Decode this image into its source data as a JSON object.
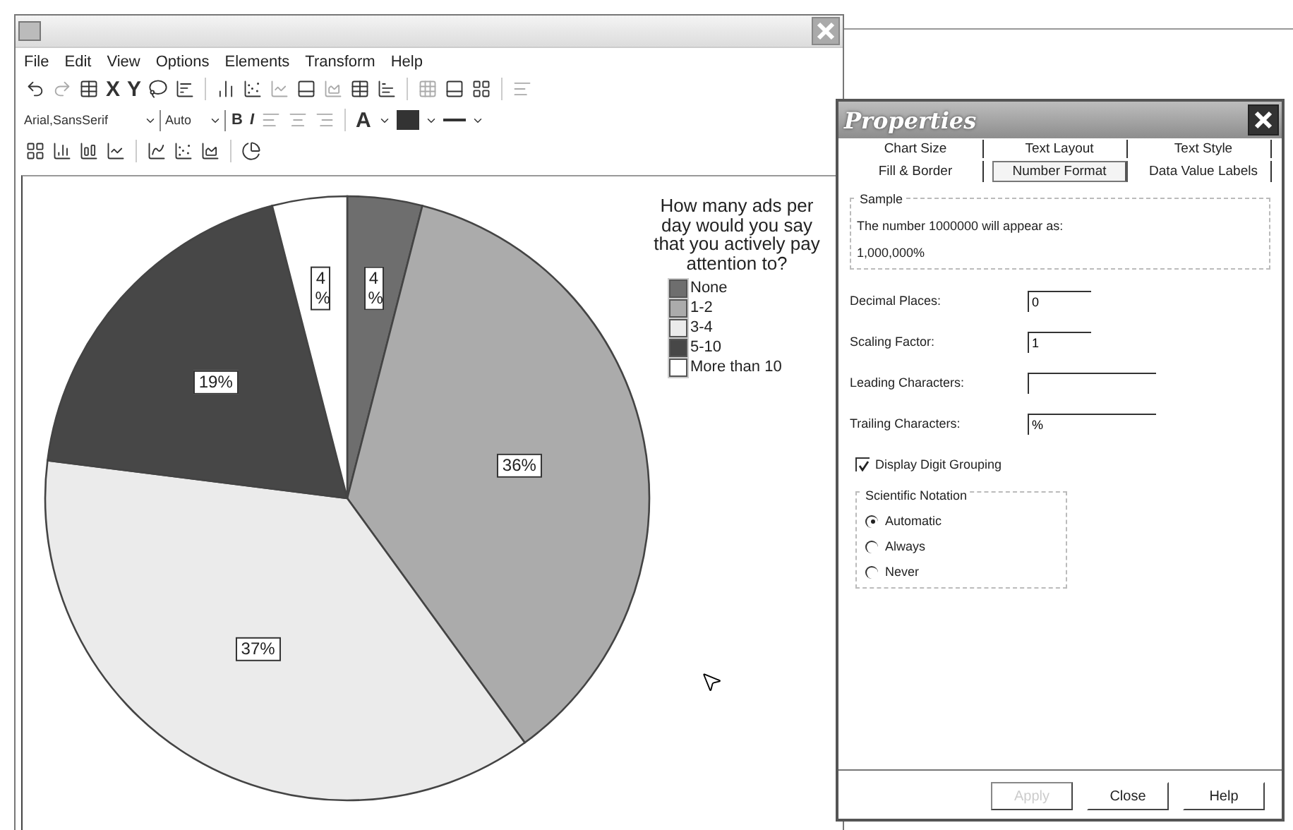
{
  "menu": [
    "File",
    "Edit",
    "View",
    "Options",
    "Elements",
    "Transform",
    "Help"
  ],
  "toolbar": {
    "x_axis": "X",
    "y_axis": "Y",
    "font": "Arial,SansSerif",
    "size": "Auto",
    "bold": "B",
    "italic": "I",
    "text_color": "A"
  },
  "chart": {
    "chart_data": {
      "type": "pie",
      "title": "How many ads per day would you say that you actively pay attention to?",
      "categories": [
        "None",
        "1-2",
        "3-4",
        "5-10",
        "More than 10"
      ],
      "values": [
        4,
        36,
        37,
        19,
        4
      ],
      "data_labels": true,
      "value_labels": [
        "4%",
        "36%",
        "37%",
        "19%",
        "4%"
      ]
    },
    "legend": [
      {
        "color": "#6e6e6e"
      },
      {
        "color": "#ababab"
      },
      {
        "color": "#ebebeb"
      },
      {
        "color": "#474747"
      },
      {
        "color": "#ffffff"
      }
    ]
  },
  "dialog": {
    "title": "Properties",
    "tab_rows": [
      [
        {
          "label": "Chart Size",
          "selected": false
        },
        {
          "label": "Text Layout",
          "selected": false
        },
        {
          "label": "Text Style",
          "selected": false
        }
      ],
      [
        {
          "label": "Fill & Border",
          "selected": false
        },
        {
          "label": "Number Format",
          "selected": true
        },
        {
          "label": "Data Value Labels",
          "selected": false
        }
      ]
    ],
    "sample": {
      "title": "Sample",
      "text": "The number 1000000 will appear as:",
      "value": "1,000,000%"
    },
    "fields": [
      {
        "label": "Decimal Places:",
        "value": "0"
      },
      {
        "label": "Scaling Factor:",
        "value": "1"
      },
      {
        "label": "Leading Characters:"
      },
      {
        "label": "Trailing Characters:",
        "value": "%"
      }
    ],
    "digit_grouping": {
      "label": "Display Digit Grouping",
      "checked": true
    },
    "notation": {
      "title": "Scientific Notation",
      "options": [
        {
          "label": "Automatic",
          "selected": true
        },
        {
          "label": "Always",
          "selected": false
        },
        {
          "label": "Never",
          "selected": false
        }
      ]
    },
    "buttons": [
      {
        "label": "Apply",
        "disabled": true
      },
      {
        "label": "Close",
        "disabled": false
      },
      {
        "label": "Help",
        "disabled": false
      }
    ]
  }
}
